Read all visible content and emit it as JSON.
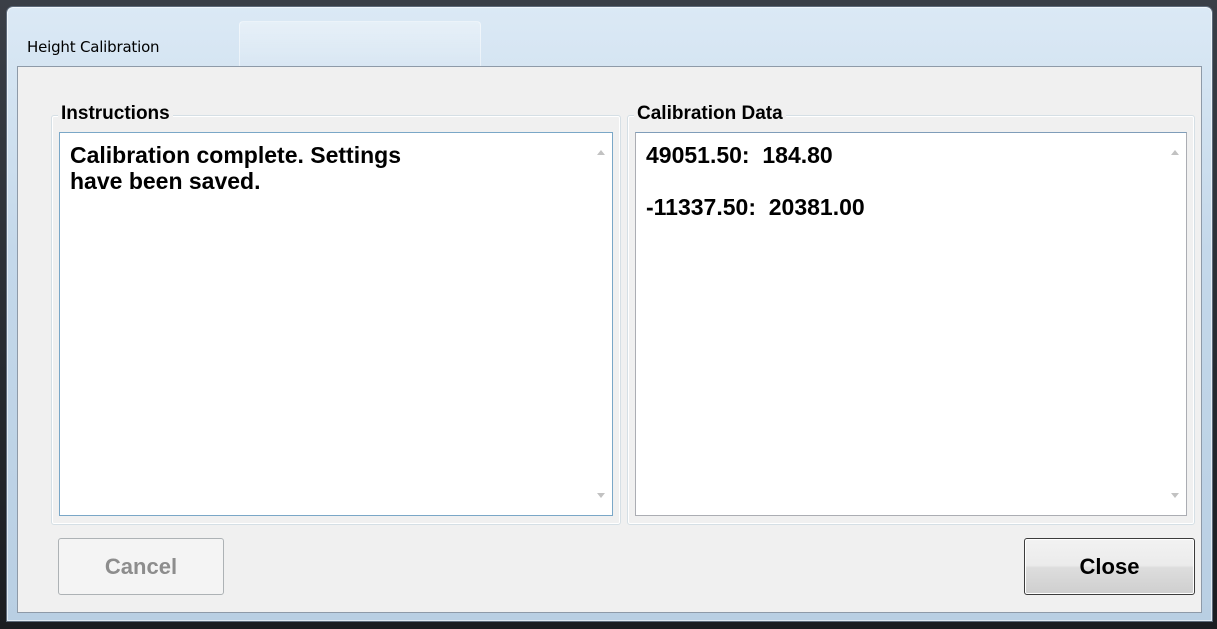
{
  "window": {
    "title": "Height Calibration"
  },
  "instructions": {
    "label": "Instructions",
    "text": "Calibration complete. Settings\nhave been saved."
  },
  "calibration_data": {
    "label": "Calibration Data",
    "text": "49051.50:  184.80\n\n-11337.50:  20381.00"
  },
  "buttons": {
    "cancel_label": "Cancel",
    "close_label": "Close",
    "cancel_enabled": false
  },
  "colors": {
    "client_bg": "#f0f0f0",
    "frame_glass": "#c4d8ea",
    "disabled_text": "#8d8d8d"
  },
  "icons": {
    "scroll_up": "scroll-up-arrow-icon",
    "scroll_down": "scroll-down-arrow-icon"
  }
}
